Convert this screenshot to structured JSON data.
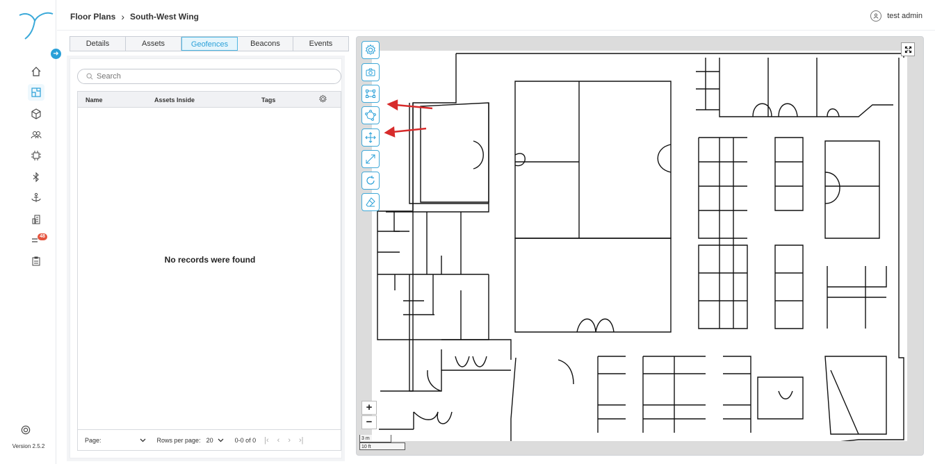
{
  "sidebar": {
    "version": "Version 2.5.2",
    "notification_count": "48",
    "items": [
      {
        "icon": "home-icon"
      },
      {
        "icon": "floor-plans-icon"
      },
      {
        "icon": "assets-icon"
      },
      {
        "icon": "people-icon"
      },
      {
        "icon": "chip-icon"
      },
      {
        "icon": "bluetooth-icon"
      },
      {
        "icon": "anchor-icon"
      },
      {
        "icon": "buildings-icon"
      },
      {
        "icon": "alerts-icon"
      },
      {
        "icon": "reports-icon"
      }
    ]
  },
  "header": {
    "breadcrumb": [
      "Floor Plans",
      "South-West Wing"
    ],
    "user_name": "test admin"
  },
  "tabs": [
    {
      "label": "Details",
      "active": false
    },
    {
      "label": "Assets",
      "active": false
    },
    {
      "label": "Geofences",
      "active": true
    },
    {
      "label": "Beacons",
      "active": false
    },
    {
      "label": "Events",
      "active": false
    }
  ],
  "search": {
    "placeholder": "Search"
  },
  "table": {
    "columns": [
      "Name",
      "Assets Inside",
      "Tags"
    ],
    "empty_message": "No records were found",
    "footer": {
      "page_label": "Page:",
      "page_value": "",
      "rows_label": "Rows per page:",
      "rows_value": "20",
      "range": "0-0 of 0"
    }
  },
  "map": {
    "tools": [
      "settings-icon",
      "camera-icon",
      "draw-rectangle-icon",
      "draw-polygon-icon",
      "move-icon",
      "resize-icon",
      "rotate-icon",
      "eraser-icon"
    ],
    "zoom_in": "+",
    "zoom_out": "−",
    "scale_metric": "3 m",
    "scale_imperial": "10 ft"
  },
  "colors": {
    "accent": "#2aa0d8",
    "arrow": "#d72b2b",
    "badge": "#e5533d"
  }
}
